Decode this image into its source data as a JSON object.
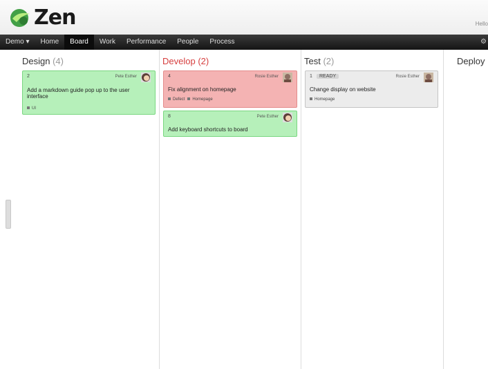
{
  "app": {
    "name": "Zen",
    "user_link": "Hello"
  },
  "nav": {
    "items": [
      {
        "label": "Demo ▾",
        "active": false
      },
      {
        "label": "Home",
        "active": false
      },
      {
        "label": "Board",
        "active": true
      },
      {
        "label": "Work",
        "active": false
      },
      {
        "label": "Performance",
        "active": false
      },
      {
        "label": "People",
        "active": false
      },
      {
        "label": "Process",
        "active": false
      }
    ]
  },
  "colors": {
    "green_card": "#b6f0ba",
    "red_card": "#f4b3b3",
    "gray_card": "#ececec",
    "accent_red": "#d63e3e"
  },
  "columns": [
    {
      "name": "Design",
      "count": "(4)",
      "cards": [
        {
          "number": "2",
          "owner": "Pete Esther",
          "title_lines": [
            "Add a markdown guide pop up to the user",
            "interface"
          ],
          "tags": [
            "UI"
          ],
          "badge": "",
          "color": "green"
        }
      ]
    },
    {
      "name": "Develop",
      "count": "(2)",
      "cards": [
        {
          "number": "4",
          "owner": "Rosie Esther",
          "title_lines": [
            "Fix alignment on homepage"
          ],
          "tags": [
            "Defect",
            "Homepage"
          ],
          "badge": "",
          "color": "red"
        },
        {
          "number": "8",
          "owner": "Pete Esther",
          "title_lines": [
            "Add keyboard shortcuts to board"
          ],
          "tags": [],
          "badge": "",
          "color": "green"
        }
      ]
    },
    {
      "name": "Test",
      "count": "(2)",
      "cards": [
        {
          "number": "1",
          "owner": "Rosie Esther",
          "title_lines": [
            "Change display on website"
          ],
          "tags": [
            "Homepage"
          ],
          "badge": "READY",
          "color": "gray"
        }
      ]
    },
    {
      "name": "Deploy",
      "count": "",
      "cards": []
    }
  ]
}
